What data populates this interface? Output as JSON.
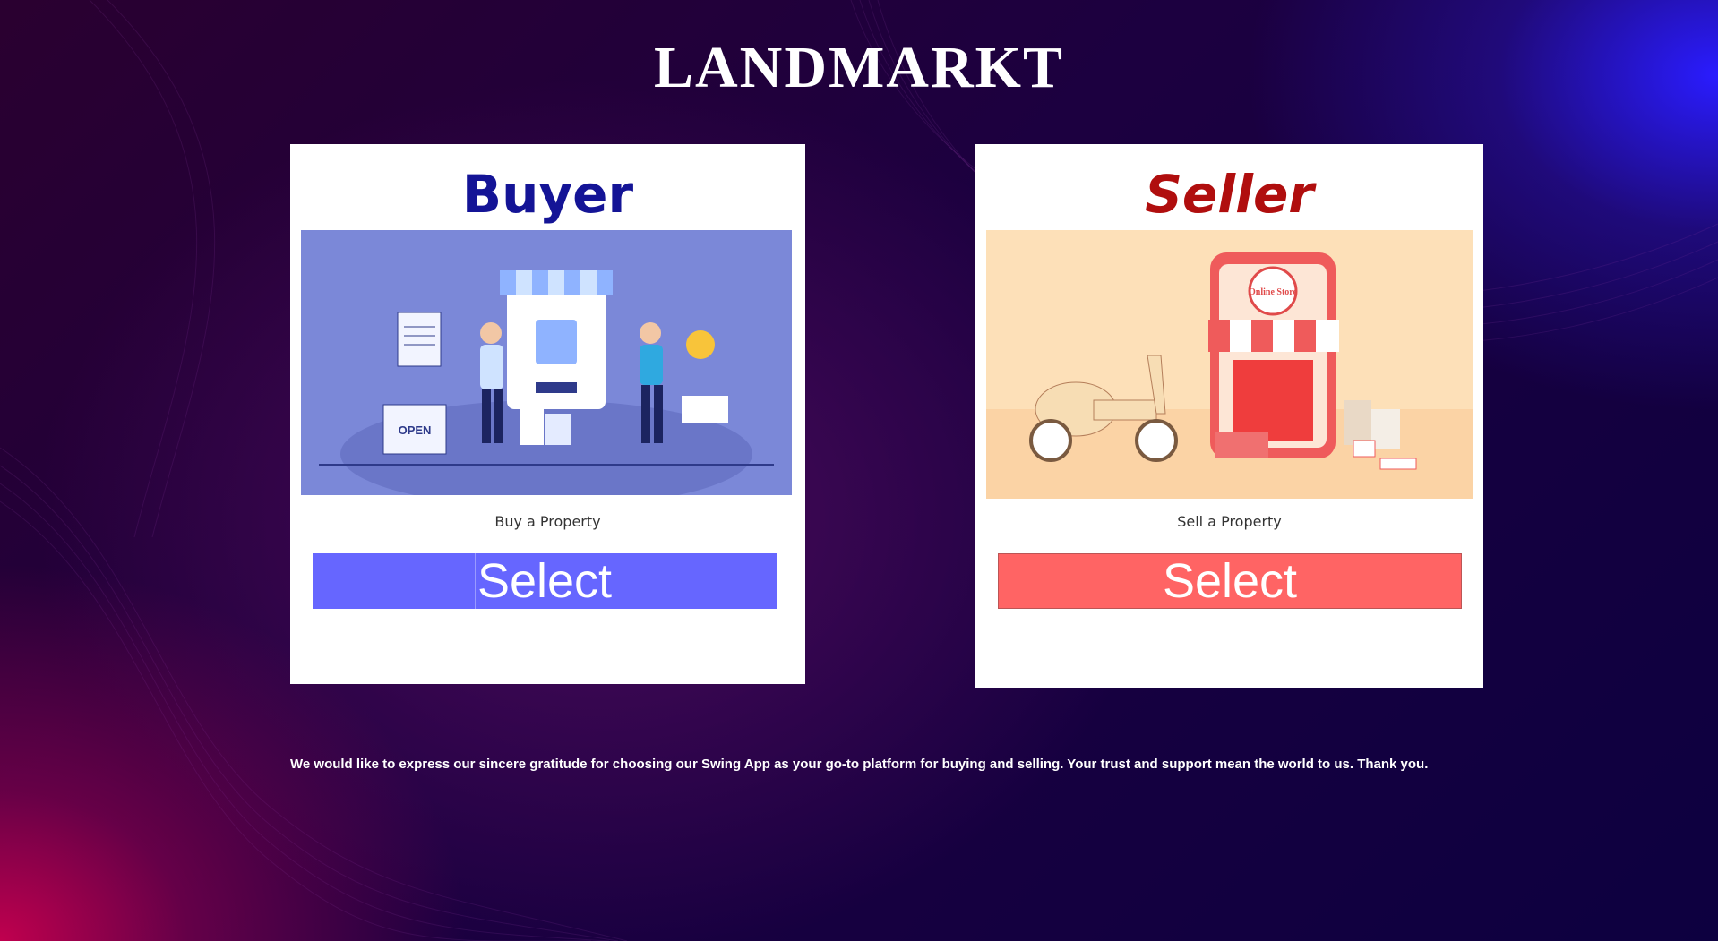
{
  "app": {
    "title": "LANDMARKT"
  },
  "cards": {
    "buyer": {
      "heading": "Buyer",
      "caption": "Buy a Property",
      "button_label": "Select",
      "illustration_text": {
        "sign": "OPEN"
      }
    },
    "seller": {
      "heading": "Seller",
      "caption": "Sell a Property",
      "button_label": "Select",
      "illustration_text": {
        "badge": "Online Store"
      }
    }
  },
  "footer": {
    "message": "We would like to express our sincere gratitude for choosing our Swing App as your go-to platform for buying and selling. Your trust and support mean the world to us. Thank you."
  },
  "colors": {
    "buyer_accent": "#141496",
    "buyer_button": "#6666ff",
    "seller_accent": "#b00e0e",
    "seller_button": "#ff6464"
  }
}
